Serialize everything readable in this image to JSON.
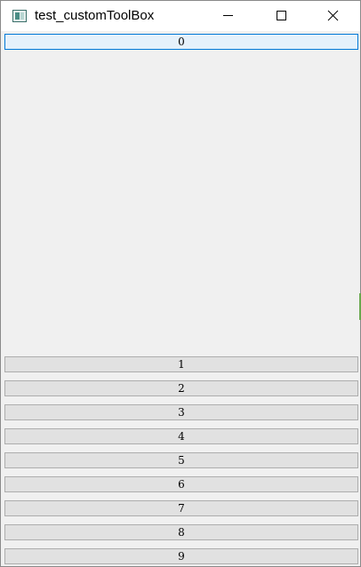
{
  "window": {
    "title": "test_customToolBox"
  },
  "controls": {
    "minimize": "minimize-icon",
    "maximize": "maximize-icon",
    "close": "close-icon"
  },
  "toolbox": {
    "items": [
      {
        "label": "0",
        "active": true
      },
      {
        "label": "1",
        "active": false
      },
      {
        "label": "2",
        "active": false
      },
      {
        "label": "3",
        "active": false
      },
      {
        "label": "4",
        "active": false
      },
      {
        "label": "5",
        "active": false
      },
      {
        "label": "6",
        "active": false
      },
      {
        "label": "7",
        "active": false
      },
      {
        "label": "8",
        "active": false
      },
      {
        "label": "9",
        "active": false
      }
    ]
  },
  "colors": {
    "active_border": "#0078d7",
    "active_bg": "#e5f1fb",
    "button_bg": "#e1e1e1",
    "window_bg": "#f0f0f0"
  }
}
